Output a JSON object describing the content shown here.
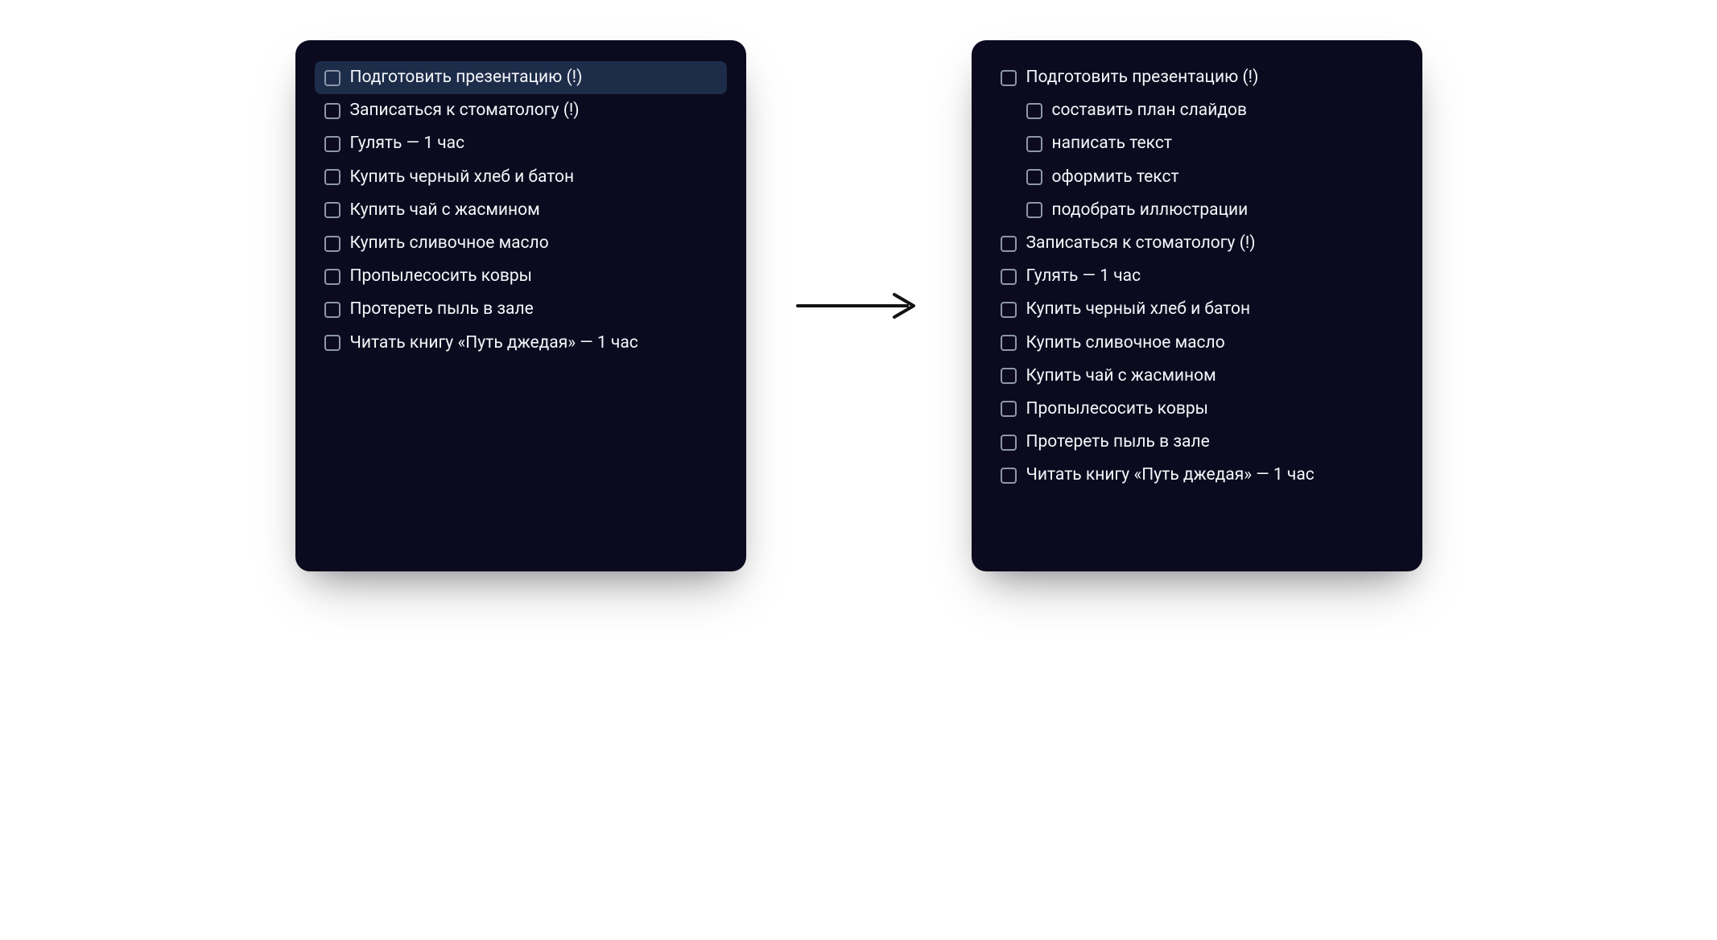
{
  "colors": {
    "panel_bg": "#0b0a1e",
    "text": "#f5f6fa",
    "checkbox_border": "#8f97a8",
    "selected_row_bg": "#1d2c49",
    "arrow": "#121214"
  },
  "left_list": {
    "items": [
      {
        "label": "Подготовить презентацию (!)",
        "selected": true,
        "indent": 0
      },
      {
        "label": "Записаться к стоматологу (!)",
        "selected": false,
        "indent": 0
      },
      {
        "label": "Гулять — 1 час",
        "selected": false,
        "indent": 0
      },
      {
        "label": "Купить черный хлеб и батон",
        "selected": false,
        "indent": 0
      },
      {
        "label": "Купить чай с жасмином",
        "selected": false,
        "indent": 0
      },
      {
        "label": "Купить сливочное масло",
        "selected": false,
        "indent": 0
      },
      {
        "label": "Пропылесосить ковры",
        "selected": false,
        "indent": 0
      },
      {
        "label": "Протереть пыль в зале",
        "selected": false,
        "indent": 0
      },
      {
        "label": "Читать книгу «Путь джедая» — 1 час",
        "selected": false,
        "indent": 0
      }
    ]
  },
  "right_list": {
    "items": [
      {
        "label": "Подготовить презентацию (!)",
        "selected": false,
        "indent": 0
      },
      {
        "label": "составить план слайдов",
        "selected": false,
        "indent": 1
      },
      {
        "label": "написать текст",
        "selected": false,
        "indent": 1
      },
      {
        "label": "оформить текст",
        "selected": false,
        "indent": 1
      },
      {
        "label": "подобрать иллюстрации",
        "selected": false,
        "indent": 1
      },
      {
        "label": "Записаться к стоматологу (!)",
        "selected": false,
        "indent": 0
      },
      {
        "label": "Гулять — 1 час",
        "selected": false,
        "indent": 0
      },
      {
        "label": "Купить черный хлеб и батон",
        "selected": false,
        "indent": 0
      },
      {
        "label": "Купить сливочное масло",
        "selected": false,
        "indent": 0
      },
      {
        "label": "Купить чай с жасмином",
        "selected": false,
        "indent": 0
      },
      {
        "label": "Пропылесосить ковры",
        "selected": false,
        "indent": 0
      },
      {
        "label": "Протереть пыль в зале",
        "selected": false,
        "indent": 0
      },
      {
        "label": "Читать книгу «Путь джедая» — 1 час",
        "selected": false,
        "indent": 0
      }
    ]
  }
}
